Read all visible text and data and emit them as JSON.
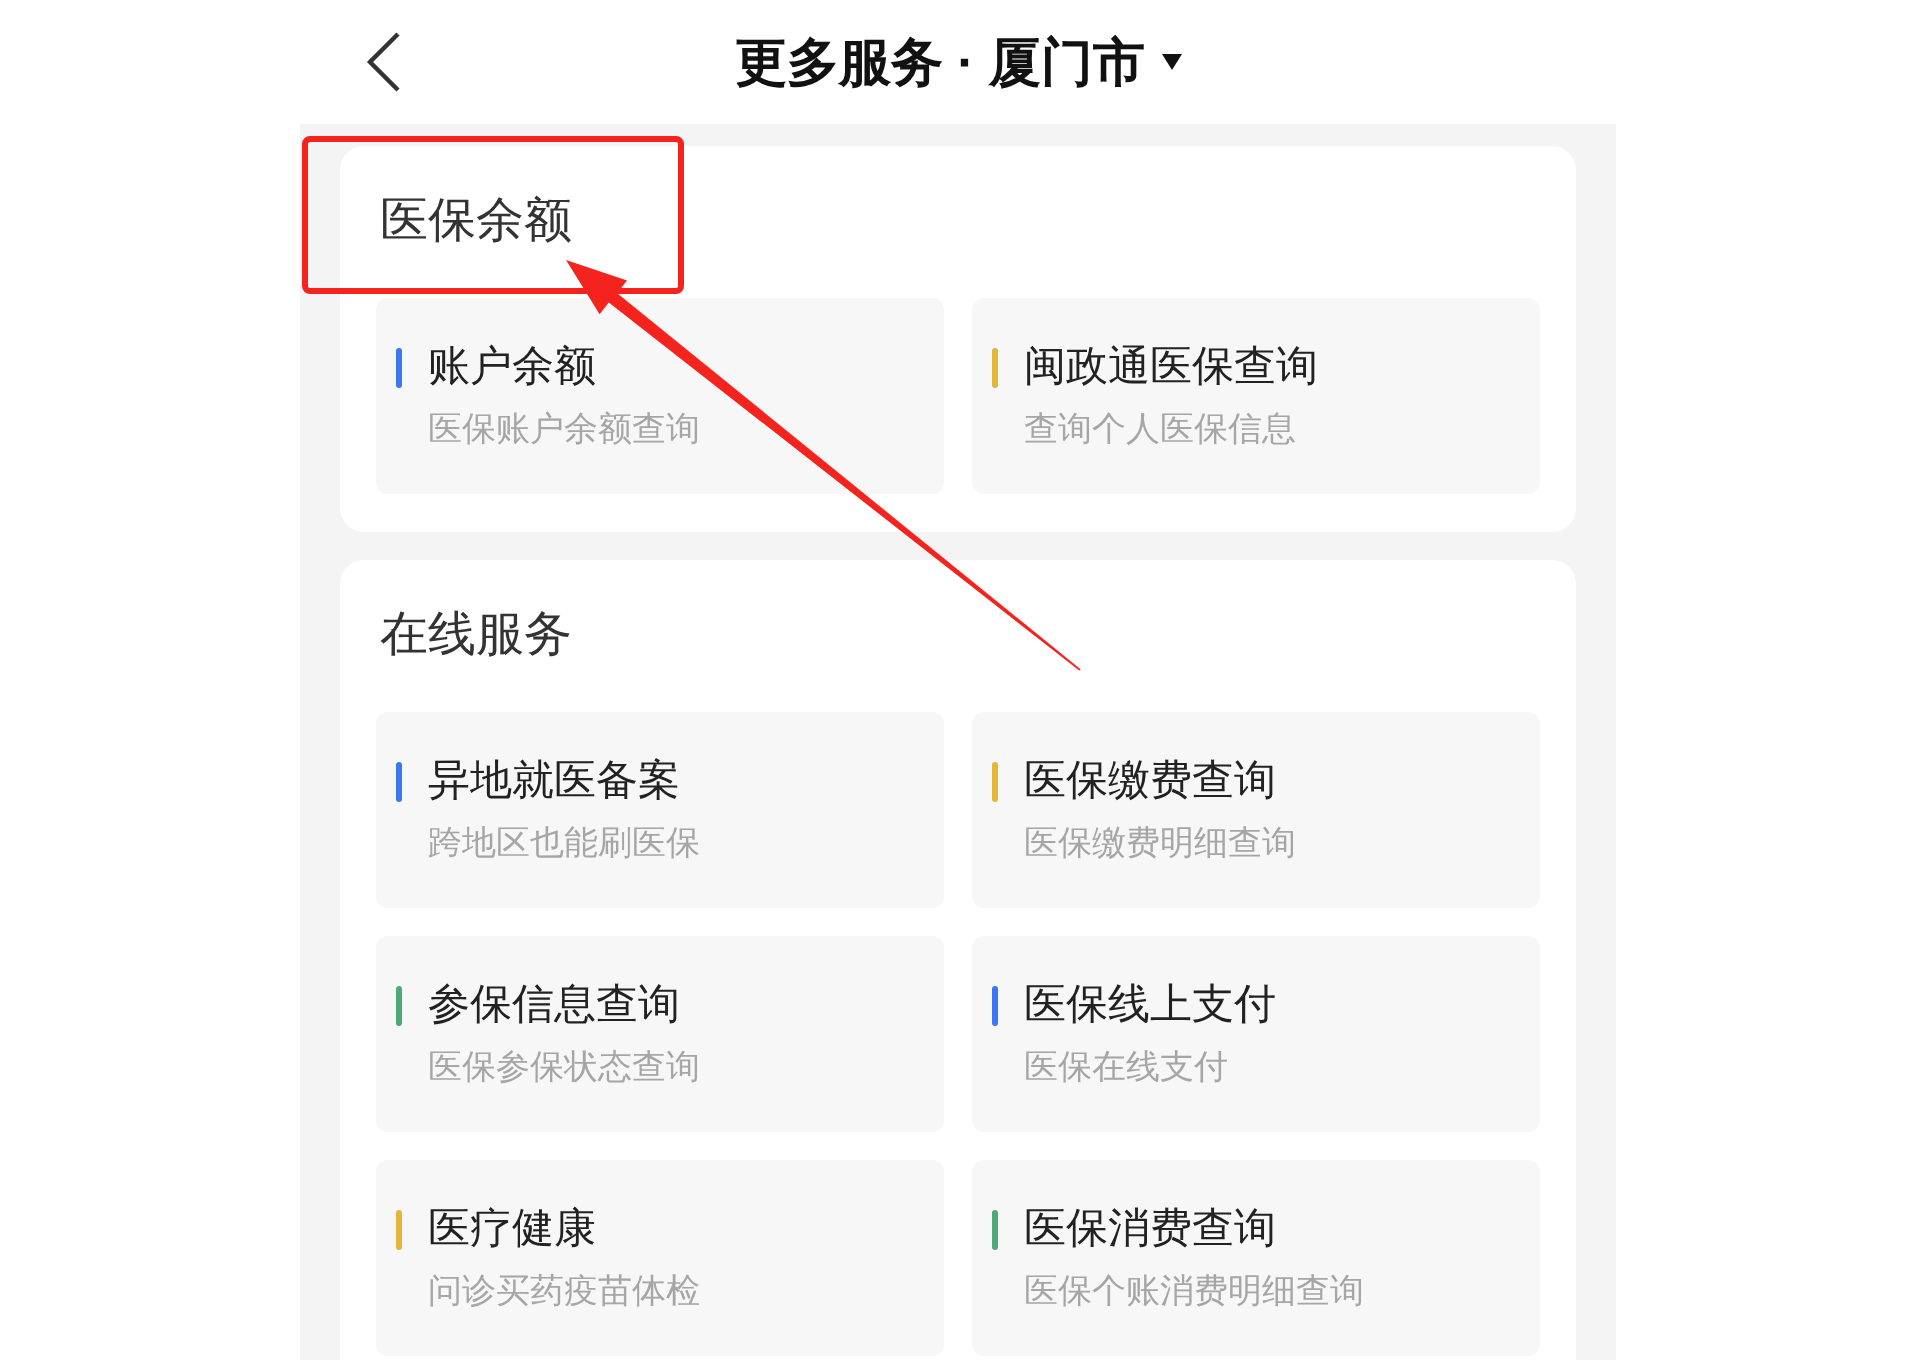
{
  "header": {
    "title": "更多服务 · 厦门市"
  },
  "sections": [
    {
      "title": "医保余额",
      "highlighted": true,
      "items": [
        {
          "title": "账户余额",
          "subtitle": "医保账户余额查询",
          "color": "#3b78f0"
        },
        {
          "title": "闽政通医保查询",
          "subtitle": "查询个人医保信息",
          "color": "#e5b53a"
        }
      ]
    },
    {
      "title": "在线服务",
      "highlighted": false,
      "items": [
        {
          "title": "异地就医备案",
          "subtitle": "跨地区也能刷医保",
          "color": "#3b78f0"
        },
        {
          "title": "医保缴费查询",
          "subtitle": "医保缴费明细查询",
          "color": "#e5b53a"
        },
        {
          "title": "参保信息查询",
          "subtitle": "医保参保状态查询",
          "color": "#4daa78"
        },
        {
          "title": "医保线上支付",
          "subtitle": "医保在线支付",
          "color": "#3b78f0"
        },
        {
          "title": "医疗健康",
          "subtitle": "问诊买药疫苗体检",
          "color": "#e5b53a"
        },
        {
          "title": "医保消费查询",
          "subtitle": "医保个账消费明细查询",
          "color": "#4daa78"
        }
      ]
    }
  ],
  "annotations": [
    {
      "kind": "arrow"
    }
  ]
}
